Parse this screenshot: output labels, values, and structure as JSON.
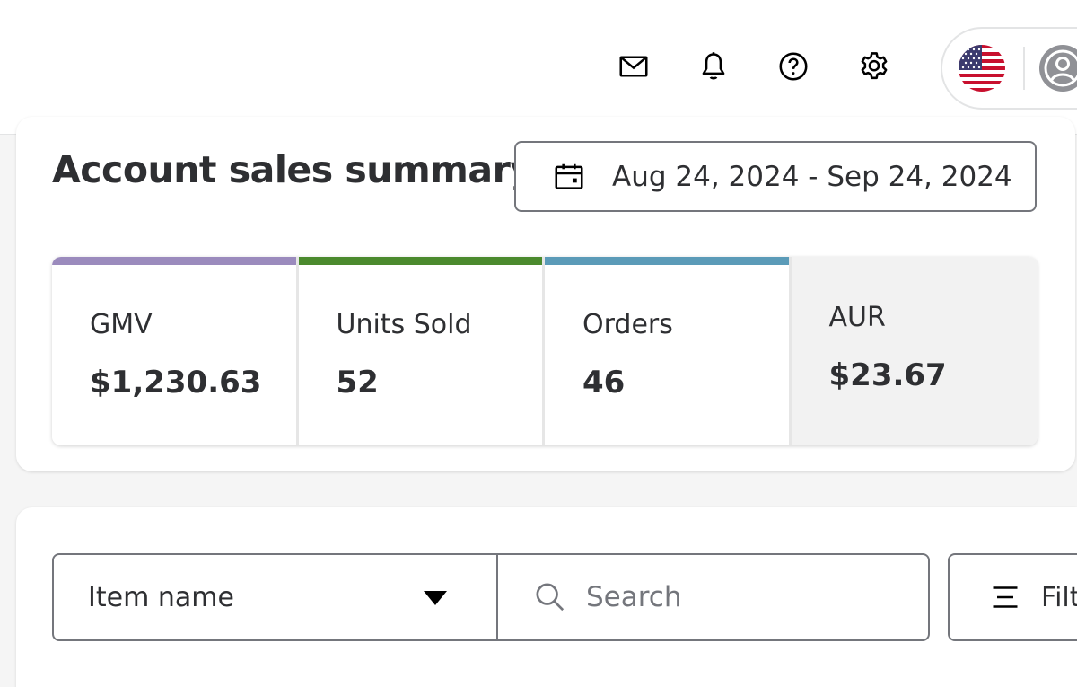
{
  "header": {
    "icons": [
      "mail-icon",
      "bell-icon",
      "help-icon",
      "settings-icon"
    ],
    "account": {
      "flag": "us-flag-icon",
      "avatar": "user-avatar-icon"
    }
  },
  "summary": {
    "title": "Account sales summary",
    "date_range": "Aug 24, 2024 - Sep 24, 2024",
    "metrics": [
      {
        "label": "GMV",
        "value": "$1,230.63",
        "color": "#9b8bbd"
      },
      {
        "label": "Units Sold",
        "value": "52",
        "color": "#4b8a2e"
      },
      {
        "label": "Orders",
        "value": "46",
        "color": "#5b9bb8"
      },
      {
        "label": "AUR",
        "value": "$23.67",
        "color": ""
      }
    ]
  },
  "filters": {
    "field_select": "Item name",
    "search_placeholder": "Search",
    "filter_label": "Filters"
  },
  "colors": {
    "text": "#2e2f32",
    "border": "#74767c",
    "background": "#f5f5f5"
  }
}
